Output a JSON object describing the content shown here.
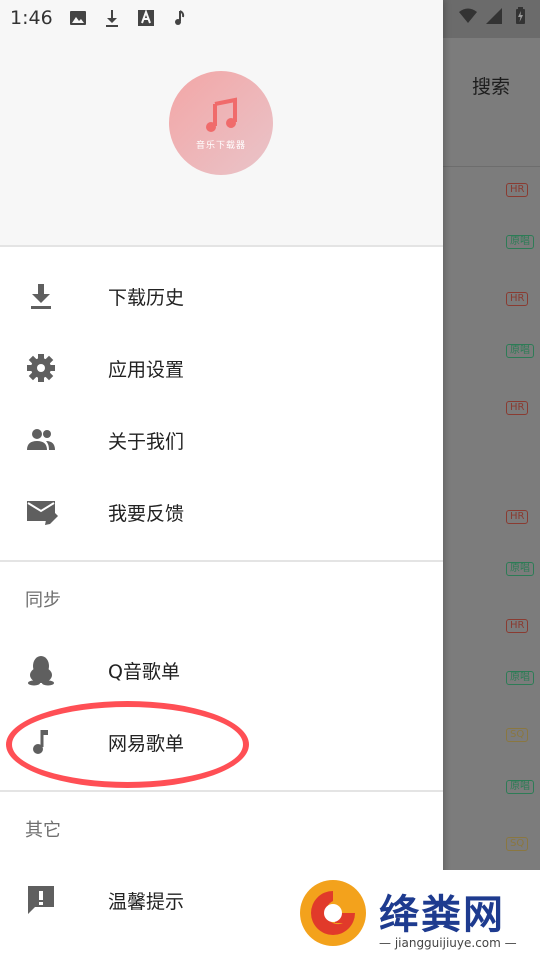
{
  "status_bar": {
    "time": "1:46",
    "icons": [
      "image-icon",
      "download-icon",
      "font-icon",
      "music-note-icon"
    ],
    "right_icons": [
      "wifi-icon",
      "signal-icon",
      "battery-charging-icon"
    ]
  },
  "background": {
    "search_label": "搜索",
    "badges": [
      {
        "type": "hr",
        "text": "HR"
      },
      {
        "type": "orig",
        "text": "原唱"
      },
      {
        "type": "hr",
        "text": "HR"
      },
      {
        "type": "orig",
        "text": "原唱"
      },
      {
        "type": "hr",
        "text": "HR"
      },
      {
        "type": "hr",
        "text": "HR"
      },
      {
        "type": "orig",
        "text": "原唱"
      },
      {
        "type": "hr",
        "text": "HR"
      },
      {
        "type": "orig",
        "text": "原唱"
      },
      {
        "type": "sq",
        "text": "SQ"
      },
      {
        "type": "orig",
        "text": "原唱"
      },
      {
        "type": "sq",
        "text": "SQ"
      }
    ]
  },
  "drawer": {
    "logo_text": "音乐下载器",
    "menu": [
      {
        "label": "下载历史",
        "icon": "download-icon"
      },
      {
        "label": "应用设置",
        "icon": "gear-icon"
      },
      {
        "label": "关于我们",
        "icon": "people-icon"
      },
      {
        "label": "我要反馈",
        "icon": "feedback-mail-icon"
      }
    ],
    "sync_section": "同步",
    "sync_items": [
      {
        "label": "Q音歌单",
        "icon": "qq-penguin-icon"
      },
      {
        "label": "网易歌单",
        "icon": "music-note-icon"
      }
    ],
    "other_section": "其它",
    "other_items": [
      {
        "label": "温馨提示",
        "icon": "alert-message-icon"
      }
    ]
  },
  "watermark": {
    "title": "绛粪网",
    "url": "— jiangguijiuye.com —"
  },
  "colors": {
    "highlight_oval": "#ff4f55",
    "logo_gradient_start": "#f3a6a6",
    "watermark_blue": "#1e3b8f"
  }
}
